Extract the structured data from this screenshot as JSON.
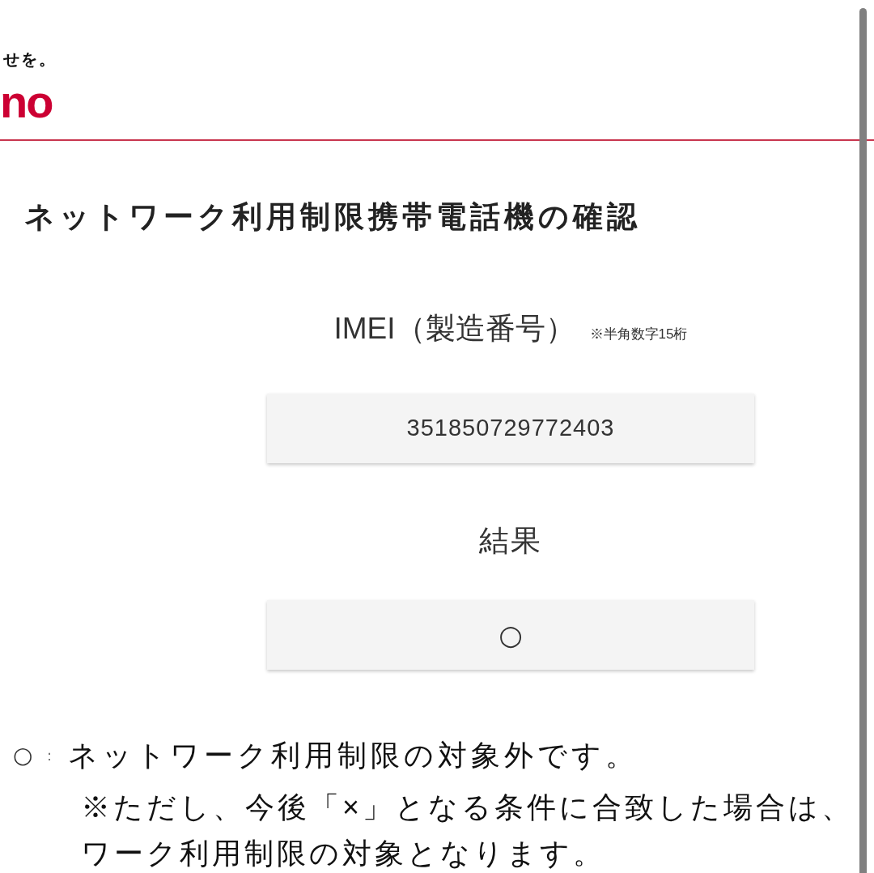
{
  "header": {
    "tagline": "せを。",
    "logo_text": "no"
  },
  "page_title": "ネットワーク利用制限携帯電話機の確認",
  "imei": {
    "label": "IMEI（製造番号）",
    "note": "※半角数字15桁",
    "value": "351850729772403"
  },
  "result": {
    "label": "結果",
    "value": "○"
  },
  "legend": [
    {
      "symbol": "○",
      "separator": "：",
      "text": "ネットワーク利用制限の対象外です。",
      "note_lines": [
        "※ただし、今後「×」となる条件に合致した場合は、",
        "ワーク利用制限の対象となります。"
      ]
    }
  ]
}
